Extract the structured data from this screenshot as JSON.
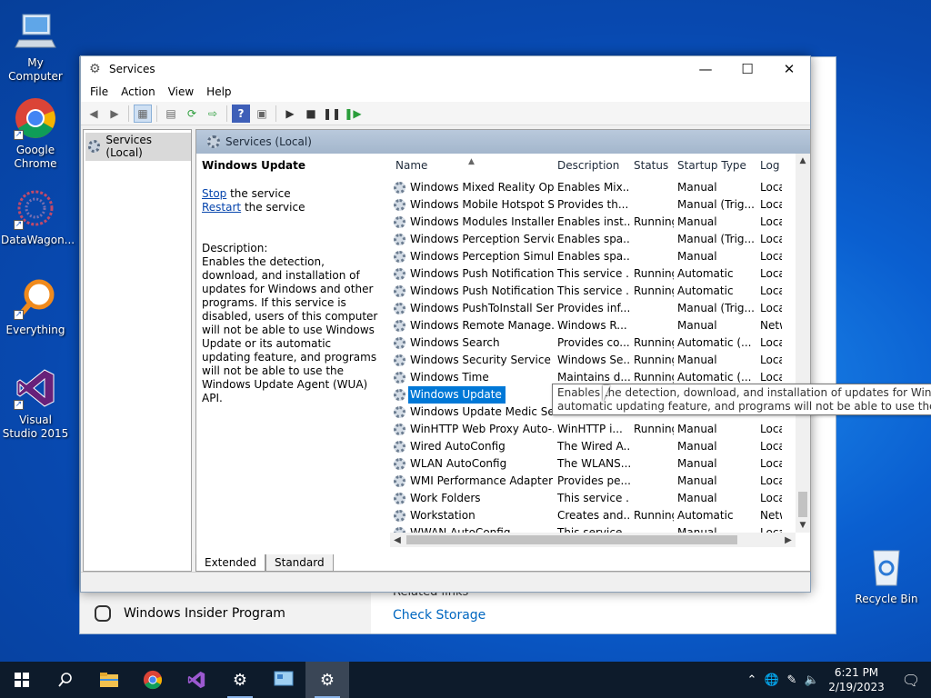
{
  "desktop": {
    "icons": [
      {
        "label": "My Computer"
      },
      {
        "label": "Google Chrome"
      },
      {
        "label": "DataWagon..."
      },
      {
        "label": "Everything"
      },
      {
        "label": "Visual Studio 2015"
      },
      {
        "label": "Recycle Bin"
      }
    ]
  },
  "background_window": {
    "insider_label": "Windows Insider Program",
    "related_label": "Related links",
    "check_storage_link": "Check Storage"
  },
  "window": {
    "title": "Services",
    "minimize": "—",
    "maximize": "☐",
    "close": "✕"
  },
  "menu": [
    "File",
    "Action",
    "View",
    "Help"
  ],
  "tree": {
    "root_label": "Services (Local)"
  },
  "content": {
    "header": "Services (Local)",
    "selected_service": "Windows Update",
    "stop_link": "Stop",
    "stop_rest": " the service",
    "restart_link": "Restart",
    "restart_rest": " the service",
    "description_label": "Description:",
    "description_text": "Enables the detection, download, and installation of updates for Windows and other programs. If this service is disabled, users of this computer will not be able to use Windows Update or its automatic updating feature, and programs will not be able to use the Windows Update Agent (WUA) API."
  },
  "columns": {
    "name": "Name",
    "description": "Description",
    "status": "Status",
    "startup": "Startup Type",
    "logon": "Log"
  },
  "services": [
    {
      "name": "Windows Mixed Reality Op...",
      "desc": "Enables Mix...",
      "status": "",
      "startup": "Manual",
      "logon": "Loca"
    },
    {
      "name": "Windows Mobile Hotspot S...",
      "desc": "Provides th...",
      "status": "",
      "startup": "Manual (Trig...",
      "logon": "Loca"
    },
    {
      "name": "Windows Modules Installer",
      "desc": "Enables inst...",
      "status": "Running",
      "startup": "Manual",
      "logon": "Loca"
    },
    {
      "name": "Windows Perception Service",
      "desc": "Enables spa...",
      "status": "",
      "startup": "Manual (Trig...",
      "logon": "Loca"
    },
    {
      "name": "Windows Perception Simul...",
      "desc": "Enables spa...",
      "status": "",
      "startup": "Manual",
      "logon": "Loca"
    },
    {
      "name": "Windows Push Notification...",
      "desc": "This service ...",
      "status": "Running",
      "startup": "Automatic",
      "logon": "Loca"
    },
    {
      "name": "Windows Push Notification...",
      "desc": "This service ...",
      "status": "Running",
      "startup": "Automatic",
      "logon": "Loca"
    },
    {
      "name": "Windows PushToInstall Serv...",
      "desc": "Provides inf...",
      "status": "",
      "startup": "Manual (Trig...",
      "logon": "Loca"
    },
    {
      "name": "Windows Remote Manage...",
      "desc": "Windows R...",
      "status": "",
      "startup": "Manual",
      "logon": "Netw"
    },
    {
      "name": "Windows Search",
      "desc": "Provides co...",
      "status": "Running",
      "startup": "Automatic (...",
      "logon": "Loca"
    },
    {
      "name": "Windows Security Service",
      "desc": "Windows Se...",
      "status": "Running",
      "startup": "Manual",
      "logon": "Loca"
    },
    {
      "name": "Windows Time",
      "desc": "Maintains d...",
      "status": "Running",
      "startup": "Automatic (...",
      "logon": "Loca"
    },
    {
      "name": "Windows Update",
      "desc": "",
      "status": "",
      "startup": "",
      "logon": "",
      "selected": true
    },
    {
      "name": "Windows Update Medic Ser...",
      "desc": "",
      "status": "",
      "startup": "",
      "logon": ""
    },
    {
      "name": "WinHTTP Web Proxy Auto-...",
      "desc": "WinHTTP i...",
      "status": "Running",
      "startup": "Manual",
      "logon": "Loca"
    },
    {
      "name": "Wired AutoConfig",
      "desc": "The Wired A...",
      "status": "",
      "startup": "Manual",
      "logon": "Loca"
    },
    {
      "name": "WLAN AutoConfig",
      "desc": "The WLANS...",
      "status": "",
      "startup": "Manual",
      "logon": "Loca"
    },
    {
      "name": "WMI Performance Adapter",
      "desc": "Provides pe...",
      "status": "",
      "startup": "Manual",
      "logon": "Loca"
    },
    {
      "name": "Work Folders",
      "desc": "This service ...",
      "status": "",
      "startup": "Manual",
      "logon": "Loca"
    },
    {
      "name": "Workstation",
      "desc": "Creates and...",
      "status": "Running",
      "startup": "Automatic",
      "logon": "Netw"
    },
    {
      "name": "WWAN AutoConfig",
      "desc": "This service ...",
      "status": "",
      "startup": "Manual",
      "logon": "Loca"
    }
  ],
  "tooltip": {
    "line1": "Enables the detection, download, and installation of updates for Windows and",
    "line2": "automatic updating feature, and programs will not be able to use the Win"
  },
  "tabs": [
    {
      "label": "Extended",
      "active": true
    },
    {
      "label": "Standard",
      "active": false
    }
  ],
  "taskbar": {
    "time": "6:21 PM",
    "date": "2/19/2023"
  }
}
